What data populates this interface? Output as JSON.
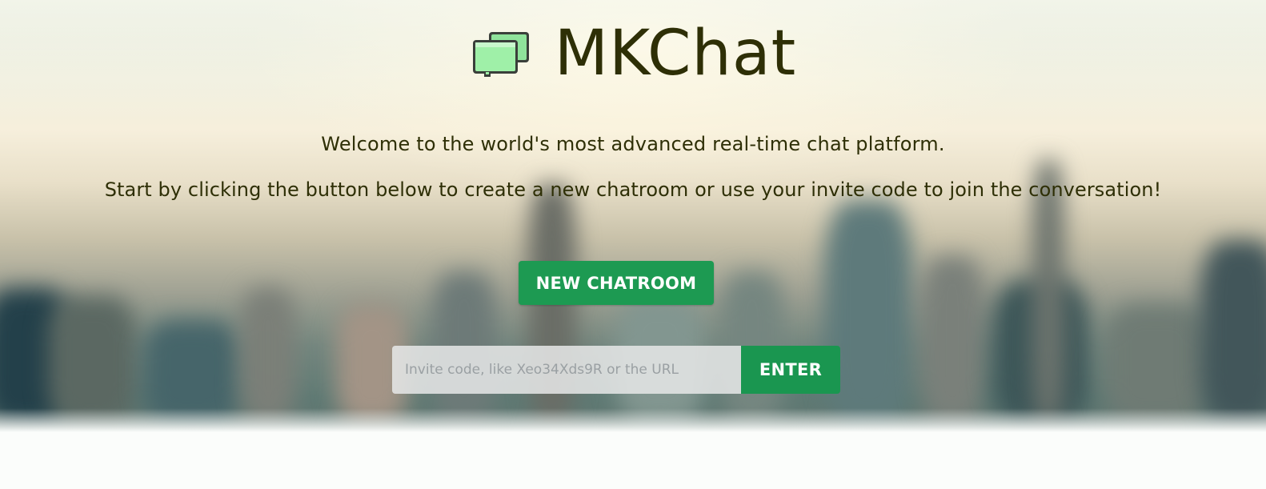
{
  "brand": {
    "title": "MKChat",
    "icon": "chat-bubbles-icon"
  },
  "hero": {
    "welcome_text": "Welcome to the world's most advanced real-time chat platform.",
    "instruction_text": "Start by clicking the button below to create a new chatroom or use your invite code to join the conversation!"
  },
  "actions": {
    "new_chatroom_label": "NEW CHATROOM",
    "invite_placeholder": "Invite code, like Xeo34Xds9R or the URL",
    "invite_value": "",
    "enter_label": "ENTER"
  },
  "colors": {
    "text": "#2e2f06",
    "button_green": "#1d9a52",
    "icon_green": "#9ff0a8"
  }
}
